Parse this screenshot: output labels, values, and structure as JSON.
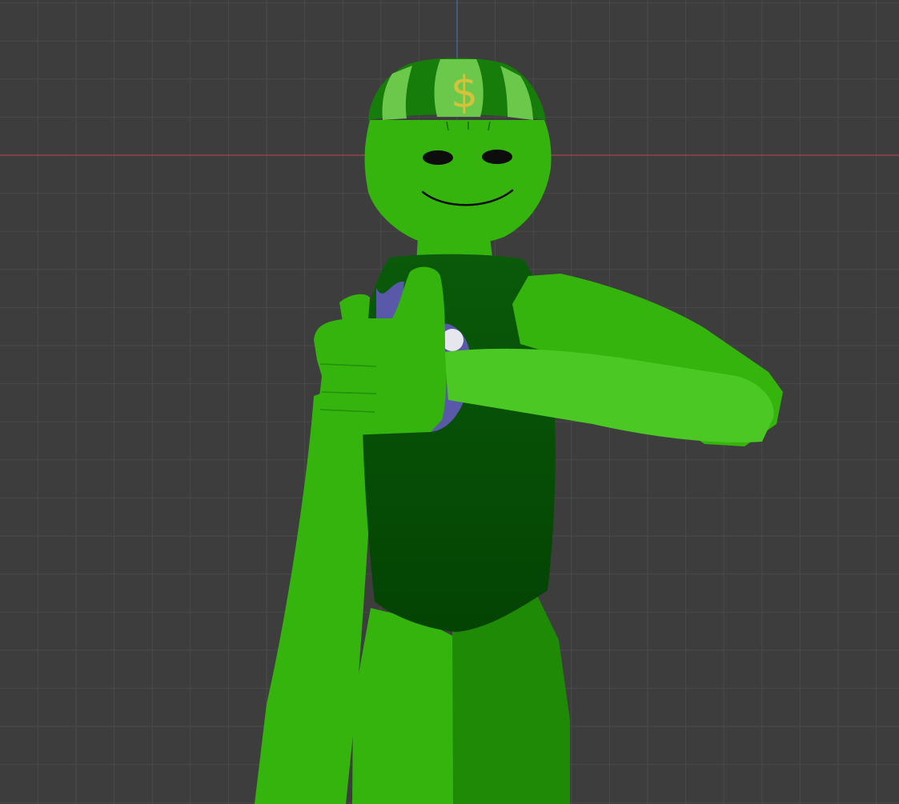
{
  "viewport": {
    "background_color": "#3d3d3d",
    "grid_minor_color": "#4a4a4a",
    "grid_major_color": "#545454",
    "x_axis_color": "#b34a4e",
    "z_axis_color": "#4a72c4",
    "grid_visible": true
  },
  "character": {
    "skin_color": "#34b40d",
    "skin_shadow_color": "#1f8a06",
    "skin_highlight_color": "#4cc825",
    "shirt_color": "#0a5a0a",
    "shirt_shadow_color": "#034303",
    "cap_color": "#2f9a1a",
    "cap_stripe_color": "#6cc84a",
    "cap_dark_color": "#167c0a",
    "dollar_symbol": "$",
    "dollar_color": "#d4c23a",
    "shirt_emblem_color": "#5a58a8",
    "eye_color": "#0d0d0d",
    "pose": "thumbs-up"
  }
}
